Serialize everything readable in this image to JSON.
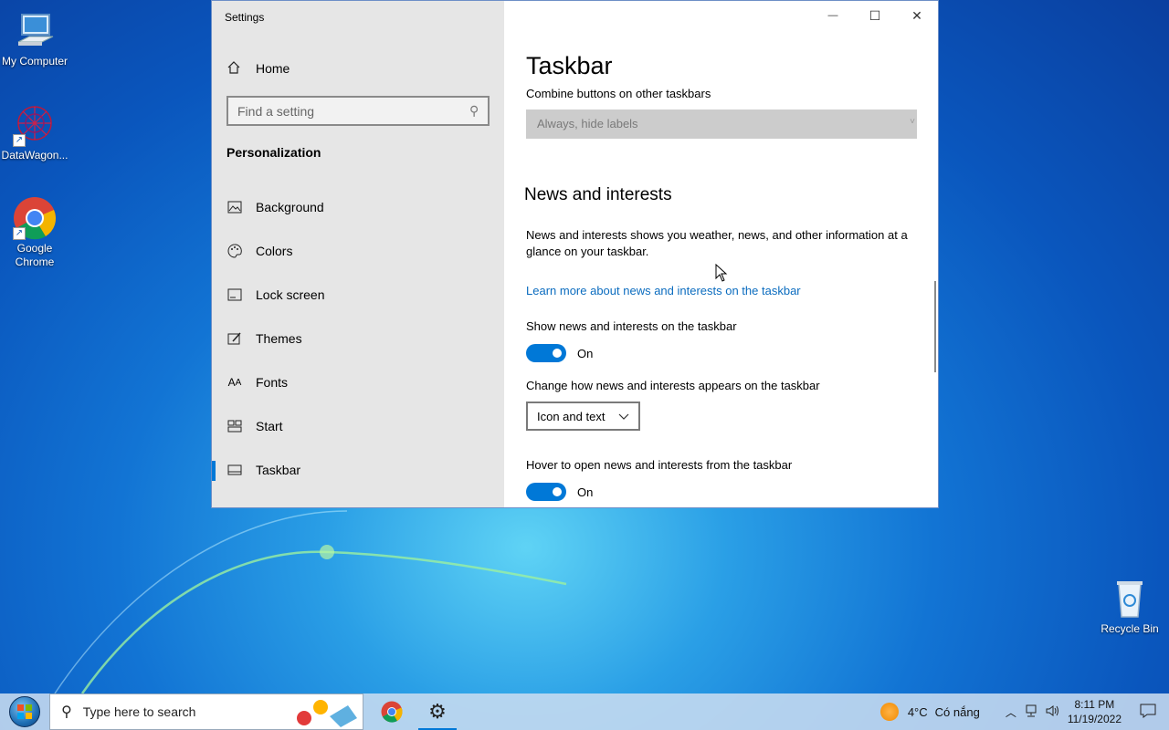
{
  "desktop": {
    "icons": [
      {
        "label": "My Computer"
      },
      {
        "label": "DataWagon..."
      },
      {
        "label": "Google Chrome"
      },
      {
        "label": "Recycle Bin"
      }
    ]
  },
  "window": {
    "title": "Settings",
    "controls": {
      "minimize": "—",
      "maximize": "☐",
      "close": "✕"
    }
  },
  "sidebar": {
    "home_label": "Home",
    "search_placeholder": "Find a setting",
    "section_title": "Personalization",
    "items": [
      {
        "label": "Background",
        "icon": "image-icon"
      },
      {
        "label": "Colors",
        "icon": "palette-icon"
      },
      {
        "label": "Lock screen",
        "icon": "lock-screen-icon"
      },
      {
        "label": "Themes",
        "icon": "themes-icon"
      },
      {
        "label": "Fonts",
        "icon": "fonts-icon"
      },
      {
        "label": "Start",
        "icon": "start-icon"
      },
      {
        "label": "Taskbar",
        "icon": "taskbar-icon",
        "selected": true
      }
    ]
  },
  "main": {
    "title": "Taskbar",
    "combine_label": "Combine buttons on other taskbars",
    "combine_value": "Always, hide labels",
    "news_title": "News and interests",
    "news_desc": "News and interests shows you weather, news, and other information at a glance on your taskbar.",
    "learn_more": "Learn more about news and interests on the taskbar",
    "show_news_label": "Show news and interests on the taskbar",
    "show_news_state": "On",
    "appearance_label": "Change how news and interests appears on the taskbar",
    "appearance_value": "Icon and text",
    "hover_label": "Hover to open news and interests from the taskbar",
    "hover_state": "On"
  },
  "taskbar": {
    "search_placeholder": "Type here to search",
    "weather_temp": "4°C",
    "weather_desc": "Có nắng",
    "time": "8:11 PM",
    "date": "11/19/2022"
  },
  "colors": {
    "accent": "#0078d7",
    "link": "#0b6cbf",
    "sidebar_bg": "#e6e6e6"
  }
}
